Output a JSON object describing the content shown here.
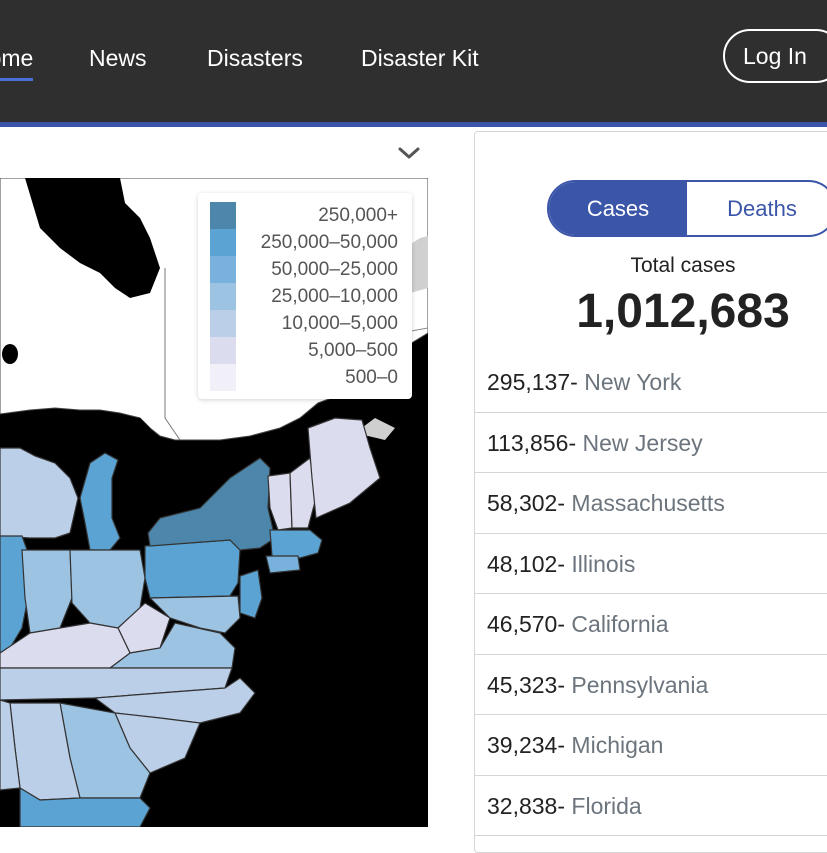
{
  "nav": {
    "items": [
      {
        "label": "Home",
        "active": true
      },
      {
        "label": "News",
        "active": false
      },
      {
        "label": "Disasters",
        "active": false
      },
      {
        "label": "Disaster Kit",
        "active": false
      }
    ],
    "login_label": "Log In"
  },
  "map": {
    "legend": [
      {
        "label": "250,000+",
        "color": "#4d86ab"
      },
      {
        "label": "250,000–50,000",
        "color": "#5ba3d2"
      },
      {
        "label": "50,000–25,000",
        "color": "#78b2dc"
      },
      {
        "label": "25,000–10,000",
        "color": "#9dc3e2"
      },
      {
        "label": "10,000–5,000",
        "color": "#bccfe8"
      },
      {
        "label": "5,000–500",
        "color": "#dcdcef"
      },
      {
        "label": "500–0",
        "color": "#f1eff8"
      }
    ]
  },
  "stats": {
    "tabs": {
      "cases": "Cases",
      "deaths": "Deaths",
      "active": "cases"
    },
    "total_label": "Total cases",
    "total_value": "1,012,683",
    "separator": "- ",
    "states": [
      {
        "count": "295,137",
        "name": "New York"
      },
      {
        "count": "113,856",
        "name": "New Jersey"
      },
      {
        "count": "58,302",
        "name": "Massachusetts"
      },
      {
        "count": "48,102",
        "name": "Illinois"
      },
      {
        "count": "46,570",
        "name": "California"
      },
      {
        "count": "45,323",
        "name": "Pennsylvania"
      },
      {
        "count": "39,234",
        "name": "Michigan"
      },
      {
        "count": "32,838",
        "name": "Florida"
      }
    ]
  },
  "colors": {
    "nav_bg": "#2f2f2f",
    "accent": "#3b55a8",
    "water": "#000000"
  }
}
